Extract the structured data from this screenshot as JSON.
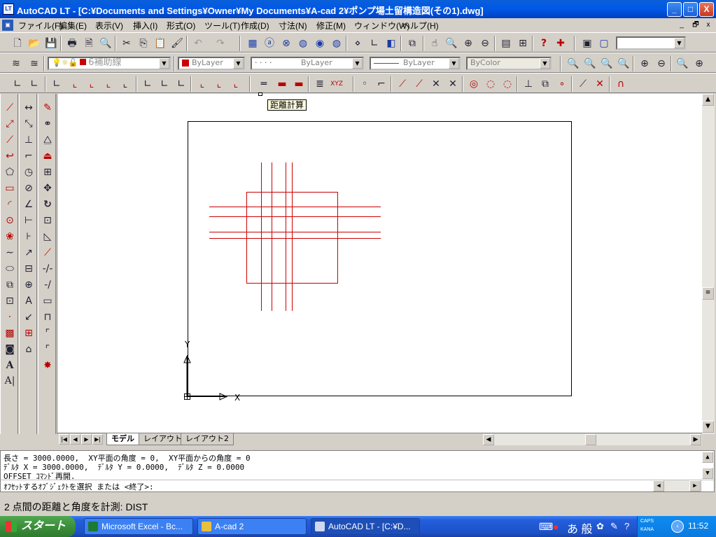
{
  "titlebar": {
    "icon": "LT",
    "title": "AutoCAD LT - [C:¥Documents and Settings¥Owner¥My Documents¥A-cad 2¥ポンプ場土留構造図(その1).dwg]",
    "minimize": "_",
    "maximize": "□",
    "close": "X"
  },
  "menubar": {
    "items": [
      "ファイル(F)",
      "編集(E)",
      "表示(V)",
      "挿入(I)",
      "形式(O)",
      "ツール(T)",
      "作成(D)",
      "寸法(N)",
      "修正(M)",
      "ウィンドウ(W)",
      "ヘルプ(H)"
    ],
    "doc_minimize": "_",
    "doc_restore": "🗗",
    "doc_close": "x"
  },
  "layer_toolbar": {
    "layer_name": "6補助線",
    "color": "ByLayer",
    "linetype": "ByLayer",
    "lineweight": "ByLayer",
    "plotstyle": "ByColor",
    "color_swatch": "#cc0000"
  },
  "tooltip": "距離計算",
  "layout_tabs": [
    "モデル",
    "レイアウト1",
    "レイアウト2"
  ],
  "command": {
    "lines": [
      "長さ = 3000.0000,  XY平面の角度 = 0,  XY平面からの角度 = 0",
      "ﾃﾞﾙﾀ X = 3000.0000,  ﾃﾞﾙﾀ Y = 0.0000,  ﾃﾞﾙﾀ Z = 0.0000",
      "OFFSET ｺﾏﾝﾄﾞ再開.",
      "ｵﾌｾｯﾄするｵﾌﾞｼﾞｪｸﾄを選択 または <終了>:"
    ]
  },
  "statusbar": {
    "text": "2 点間の距離と角度を計測:  DIST"
  },
  "taskbar": {
    "start": "スタート",
    "tasks": [
      {
        "label": "Microsoft Excel - Bc...",
        "icon_color": "#1d7a34"
      },
      {
        "label": "A-cad 2",
        "icon_color": "#e8c040"
      },
      {
        "label": "AutoCAD LT - [C:¥D...",
        "icon_color": "#d0d8f0"
      }
    ],
    "tray": {
      "caps": "CAPS",
      "kana": "KANA",
      "ime": "あ 般",
      "time": "11:52"
    }
  },
  "drawing": {
    "stroke_color": "#cc0000",
    "ucs_x_label": "X",
    "ucs_y_label": "Y"
  }
}
